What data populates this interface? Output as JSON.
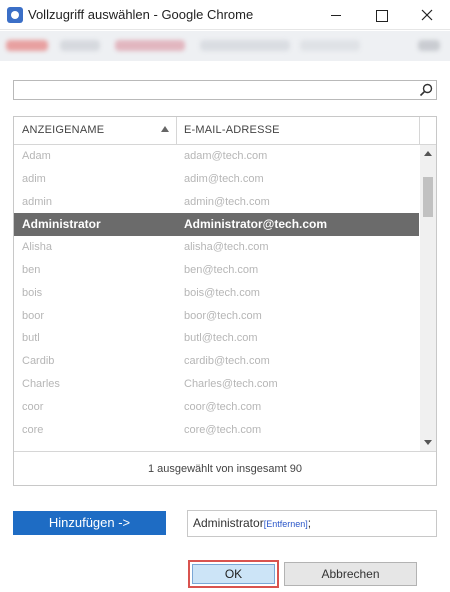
{
  "window": {
    "title": "Vollzugriff auswählen - Google Chrome"
  },
  "search": {
    "value": "",
    "placeholder": ""
  },
  "table": {
    "columns": [
      "ANZEIGENAME",
      "E-MAIL-ADRESSE"
    ],
    "sort_column": "ANZEIGENAME",
    "sort_direction": "ascending",
    "rows": [
      {
        "name": "Adam",
        "email": "adam@tech.com",
        "selected": false
      },
      {
        "name": "adim",
        "email": "adim@tech.com",
        "selected": false
      },
      {
        "name": "admin",
        "email": "admin@tech.com",
        "selected": false
      },
      {
        "name": "Administrator",
        "email": "Administrator@tech.com",
        "selected": true
      },
      {
        "name": "Alisha",
        "email": "alisha@tech.com",
        "selected": false
      },
      {
        "name": "ben",
        "email": "ben@tech.com",
        "selected": false
      },
      {
        "name": "bois",
        "email": "bois@tech.com",
        "selected": false
      },
      {
        "name": "boor",
        "email": "boor@tech.com",
        "selected": false
      },
      {
        "name": "butl",
        "email": "butl@tech.com",
        "selected": false
      },
      {
        "name": "Cardib",
        "email": "cardib@tech.com",
        "selected": false
      },
      {
        "name": "Charles",
        "email": "Charles@tech.com",
        "selected": false
      },
      {
        "name": "coor",
        "email": "coor@tech.com",
        "selected": false
      },
      {
        "name": "core",
        "email": "core@tech.com",
        "selected": false
      }
    ],
    "footer": "1 ausgewählt von insgesamt 90"
  },
  "actions": {
    "add_label": "Hinzufügen ->",
    "selected_name": "Administrator",
    "remove_label": "[Entfernen]",
    "separator": ";"
  },
  "buttons": {
    "ok": "OK",
    "cancel": "Abbrechen"
  },
  "colors": {
    "accent": "#1e6cc4",
    "selected_row": "#6b6b6b",
    "highlight_border": "#d9534f"
  }
}
